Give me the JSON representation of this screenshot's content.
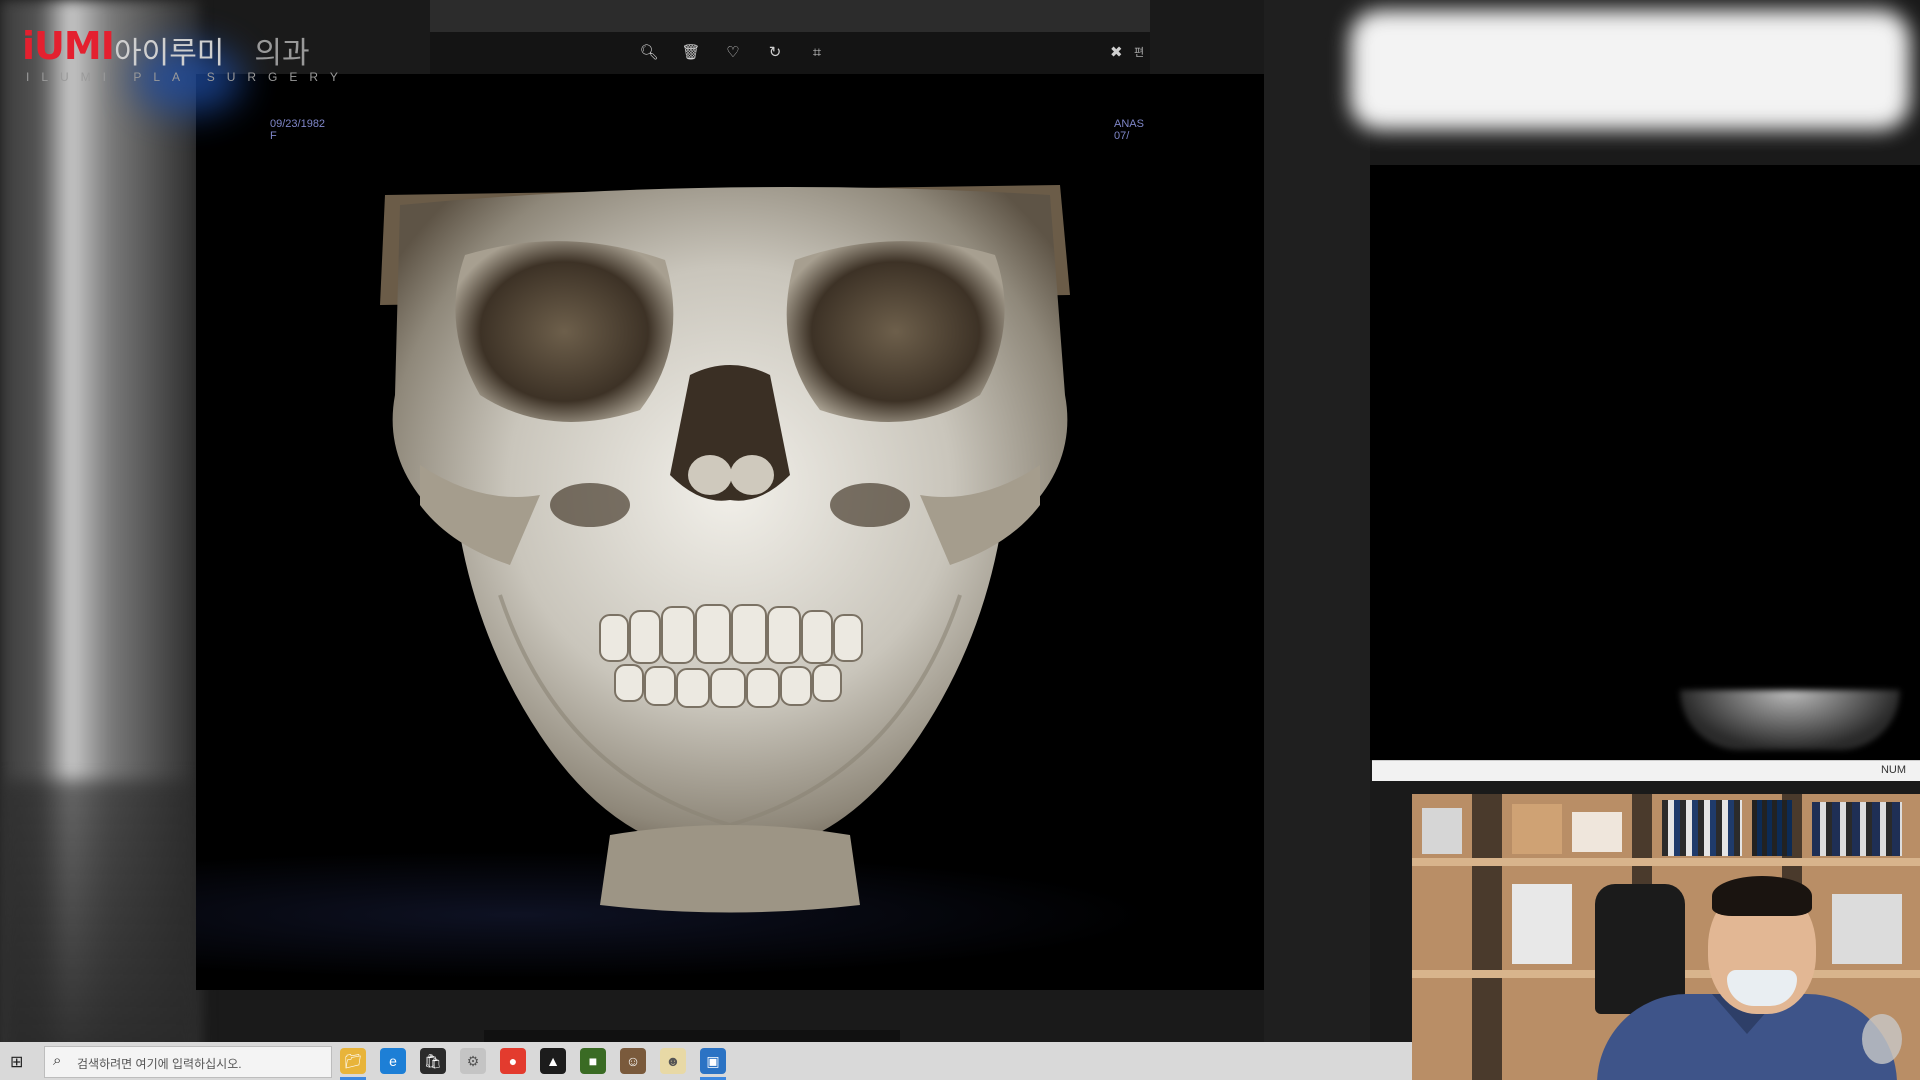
{
  "logo": {
    "mark": "iUMI",
    "name": "아이루미",
    "name_suffix": "의과",
    "subtitle": "ILUMI PLA   SURGERY"
  },
  "viewer": {
    "toolbar": {
      "icons": [
        "zoom-icon",
        "trash-icon",
        "heart-icon",
        "rotate-icon",
        "crop-icon"
      ],
      "close_label": "편"
    },
    "meta_left": {
      "date": "09/23/1982",
      "sex": "F"
    },
    "meta_right": {
      "line1": "ANAS",
      "line2": "07/"
    }
  },
  "status_bar": {
    "num": "NUM"
  },
  "taskbar": {
    "search_placeholder": "검색하려면 여기에 입력하십시오.",
    "apps": [
      "file-explorer",
      "edge",
      "store",
      "app-4",
      "chrome",
      "app-6",
      "app-7",
      "app-8",
      "app-9",
      "app-10"
    ]
  }
}
